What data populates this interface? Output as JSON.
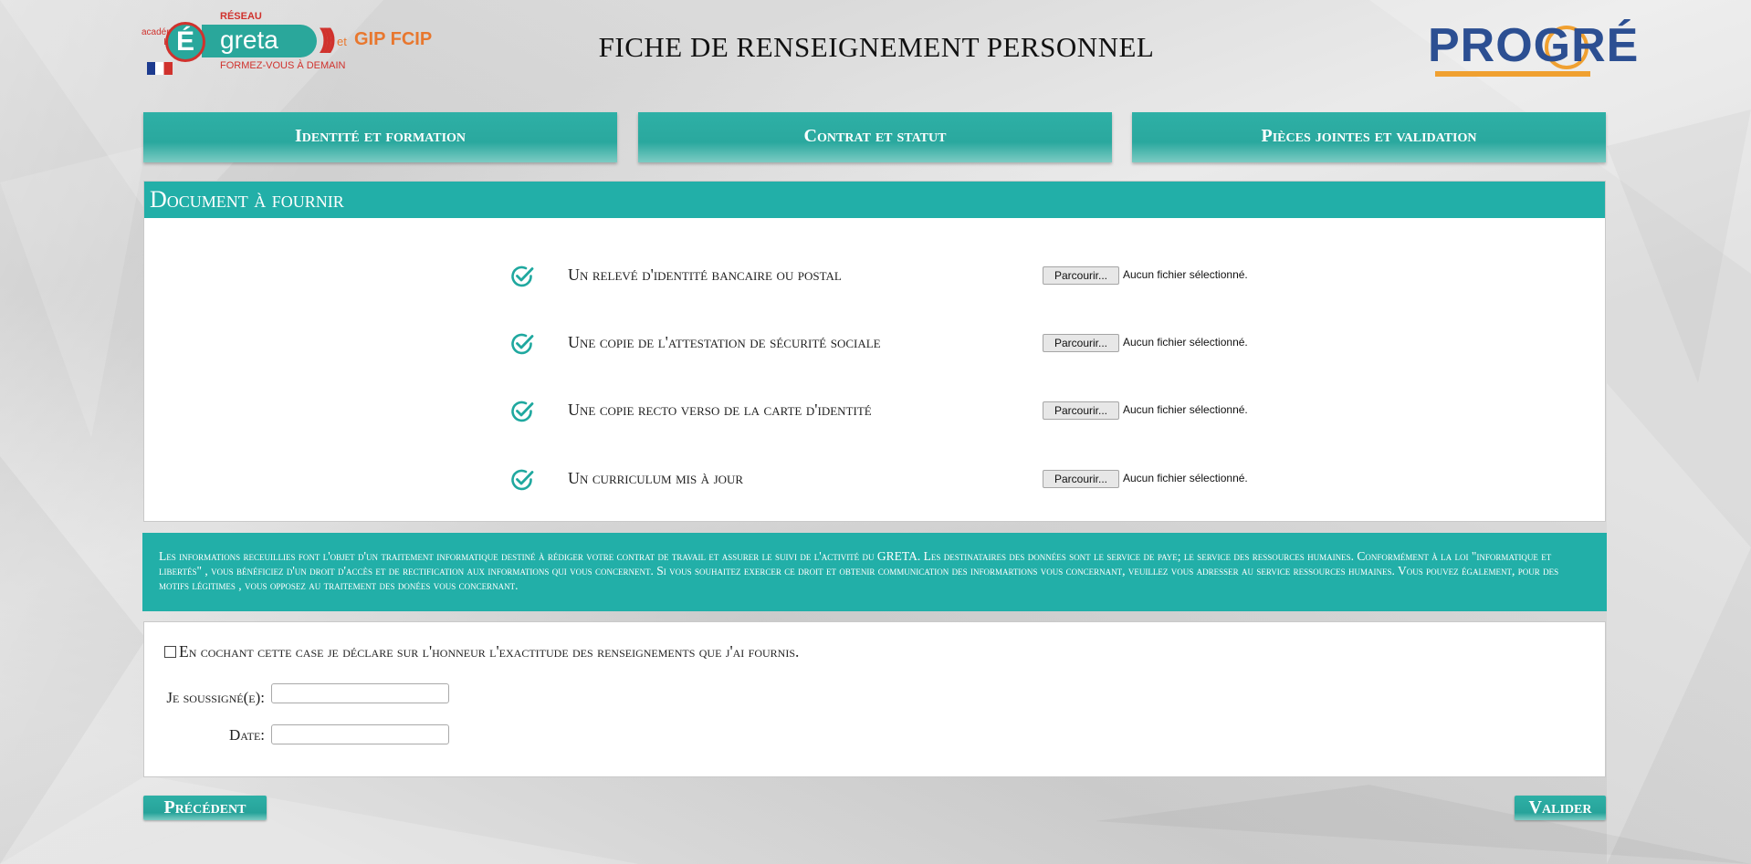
{
  "header": {
    "title": "FICHE DE RENSEIGNEMENT PERSONNEL",
    "logo_left": {
      "academie": "académie Lille",
      "reseau": "RÉSEAU",
      "e_letter": "É",
      "greta": "greta",
      "waves": ")))",
      "et": "et",
      "gip": "GIP FCIP",
      "tagline": "FORMEZ-VOUS À DEMAIN"
    },
    "logo_right": {
      "text": "PROGRÉ"
    }
  },
  "tabs": [
    {
      "label": "Identité et formation"
    },
    {
      "label": "Contrat et statut"
    },
    {
      "label": "Pièces jointes et validation"
    }
  ],
  "documents": {
    "heading": "Document à fournir",
    "browse_label": "Parcourir...",
    "no_file_label": "Aucun fichier sélectionné.",
    "items": [
      {
        "label": "Un relevé d'identité bancaire ou postal"
      },
      {
        "label": "Une copie de l'attestation de sécurité sociale"
      },
      {
        "label": "Une copie recto verso de la carte d'identité"
      },
      {
        "label": "Un curriculum mis à jour"
      }
    ]
  },
  "info_text": "Les informations receuillies font l'objet d'un traitement informatique destiné à rédiger votre contrat de travail et assurer le suivi de l'activité du GRETA. Les destinataires des données sont le service de paye;  le service des ressources humaines. Conformément à la loi \"informatique et libertés\" , vous bénéficiez d'un droit d'accès et de rectification aux informations qui vous concernent. Si vous souhaitez exercer ce droit et obtenir communication des informartions vous concernant, veuillez vous adresser au service ressources humaines. Vous pouvez également, pour des motifs légitimes , vous opposez au traitement des donées vous concernant.",
  "declaration": {
    "checkbox_label": "En cochant cette case je déclare sur l'honneur l'exactitude des renseignements que j'ai fournis.",
    "checked": false,
    "signed_label": "Je soussigné(e):",
    "signed_value": "",
    "date_label": "Date:",
    "date_value": ""
  },
  "nav": {
    "prev_label": "Précédent",
    "next_label": "Valider"
  },
  "colors": {
    "accent": "#22afa8",
    "icon": "#1fa89f"
  }
}
